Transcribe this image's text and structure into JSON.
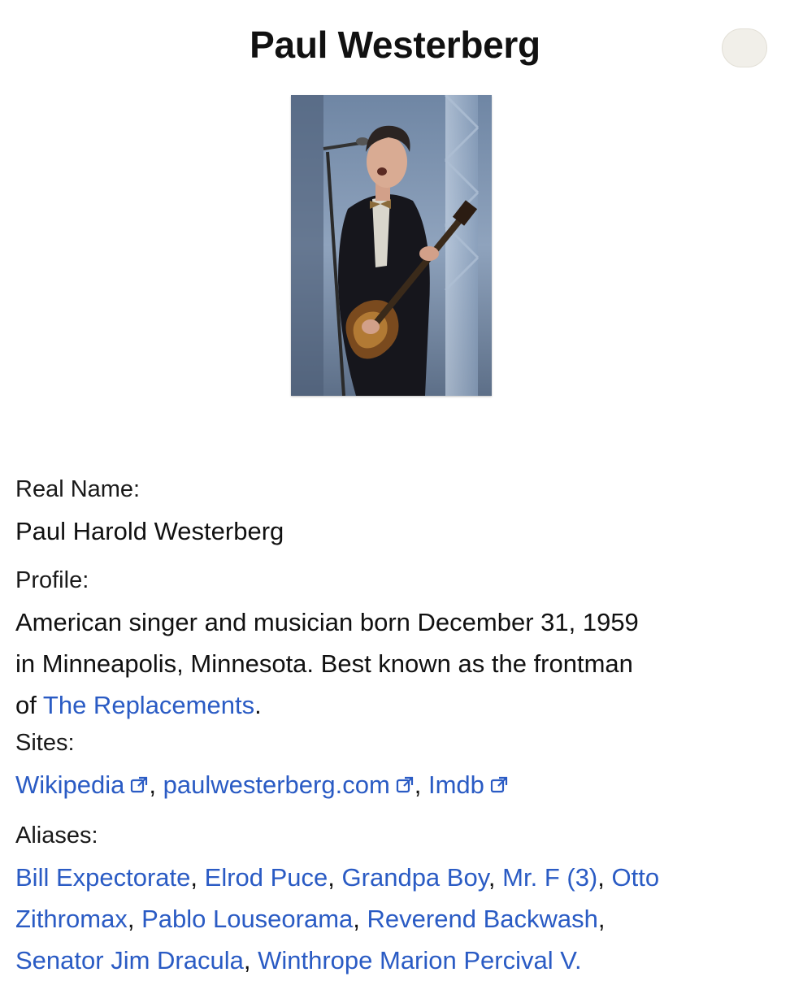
{
  "artist": {
    "name": "Paul Westerberg",
    "photo_icon": "artist-photo"
  },
  "sections": {
    "real_name": {
      "label": "Real Name:",
      "value": "Paul Harold Westerberg"
    },
    "profile": {
      "label": "Profile:",
      "text_line1": "American singer and musician born December 31, 1959",
      "text_line2": "in Minneapolis, Minnesota. Best known as the frontman",
      "text_line3_prefix": "of ",
      "link": "The Replacements",
      "text_line3_suffix": "."
    },
    "sites": {
      "label": "Sites:",
      "links": [
        "Wikipedia",
        "paulwesterberg.com",
        "Imdb"
      ],
      "separator": ", ",
      "icon": "external-link-icon"
    },
    "aliases": {
      "label": "Aliases:",
      "items": [
        "Bill Expectorate",
        "Elrod Puce",
        "Grandpa Boy",
        "Mr. F (3)",
        "Otto Zithromax",
        "Pablo Louseorama",
        "Reverend Backwash",
        "Senator Jim Dracula",
        "Winthrope Marion Percival V."
      ],
      "item_line_splits": {
        "otto_part1": "Otto",
        "otto_part2": "Zithromax"
      },
      "separator": ",",
      "end": "."
    }
  },
  "colors": {
    "link": "#2a5bc4",
    "text": "#111111"
  }
}
